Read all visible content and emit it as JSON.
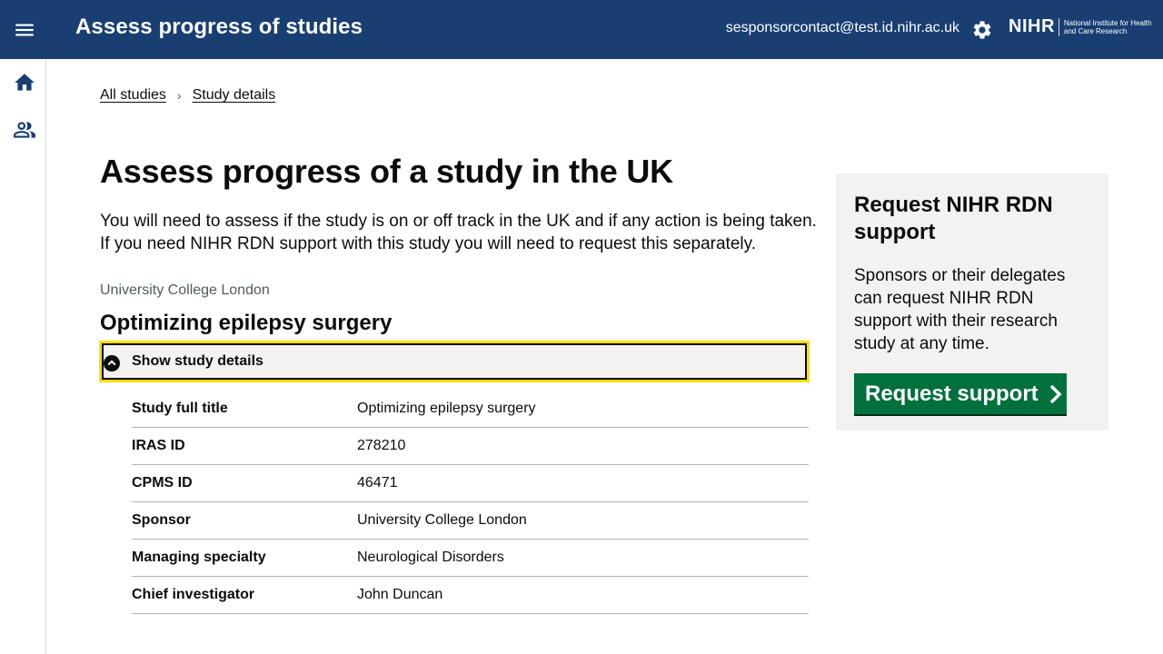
{
  "header": {
    "title": "Assess progress of studies",
    "user_email": "sesponsorcontact@test.id.nihr.ac.uk",
    "logo_mark": "NIHR",
    "logo_text": "National Institute for Health and Care Research",
    "background": "#193e72"
  },
  "sidenav": {
    "items": [
      {
        "icon": "home-icon"
      },
      {
        "icon": "people-icon"
      }
    ]
  },
  "breadcrumb": {
    "items": [
      "All studies",
      "Study details"
    ]
  },
  "page": {
    "title": "Assess progress of a study in the UK",
    "intro": "You will need to assess if the study is on or off track in the UK and if any action is being taken. If you need NIHR RDN support with this study you will need to request this separately.",
    "org_caption": "University College London",
    "study_title": "Optimizing epilepsy surgery"
  },
  "details": {
    "toggle_label": "Show study details",
    "focus_color": "#ffdd00",
    "rows": [
      {
        "key": "Study full title",
        "value": "Optimizing epilepsy surgery"
      },
      {
        "key": "IRAS ID",
        "value": "278210"
      },
      {
        "key": "CPMS ID",
        "value": "46471"
      },
      {
        "key": "Sponsor",
        "value": "University College London"
      },
      {
        "key": "Managing specialty",
        "value": "Neurological Disorders"
      },
      {
        "key": "Chief investigator",
        "value": "John Duncan"
      }
    ]
  },
  "aside": {
    "title": "Request NIHR RDN support",
    "body": "Sponsors or their delegates can request NIHR RDN support with their research study at any time.",
    "button_label": "Request support",
    "button_color": "#00703c"
  }
}
